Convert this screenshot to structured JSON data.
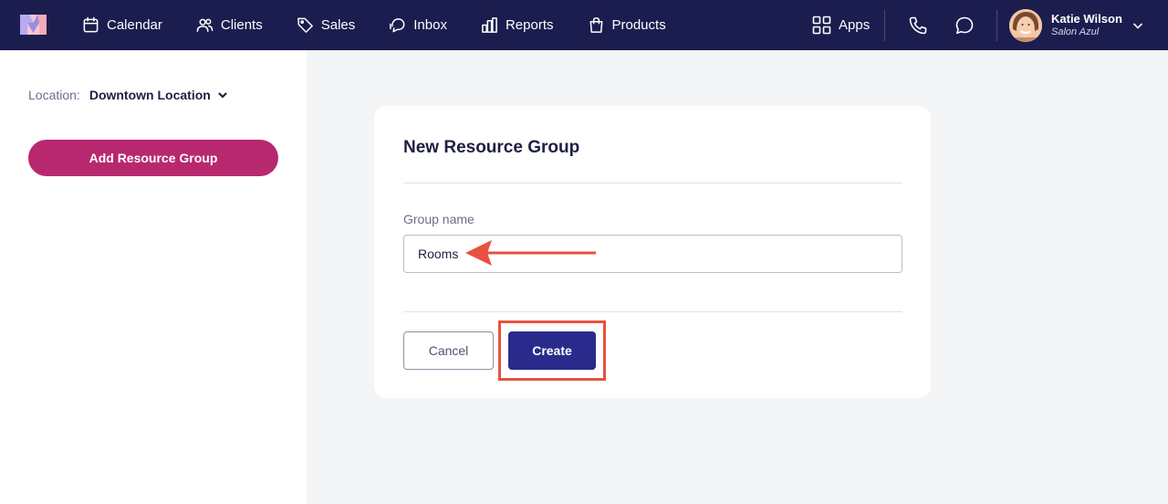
{
  "header": {
    "nav": [
      {
        "label": "Calendar",
        "icon": "calendar-icon"
      },
      {
        "label": "Clients",
        "icon": "clients-icon"
      },
      {
        "label": "Sales",
        "icon": "tag-icon"
      },
      {
        "label": "Inbox",
        "icon": "inbox-icon"
      },
      {
        "label": "Reports",
        "icon": "reports-icon"
      },
      {
        "label": "Products",
        "icon": "bag-icon"
      }
    ],
    "apps_label": "Apps",
    "user": {
      "name": "Katie Wilson",
      "business": "Salon Azul"
    }
  },
  "sidebar": {
    "location_label": "Location:",
    "location_value": "Downtown Location",
    "add_button": "Add Resource Group"
  },
  "dialog": {
    "title": "New Resource Group",
    "field_label": "Group name",
    "field_value": "Rooms",
    "cancel": "Cancel",
    "create": "Create"
  },
  "colors": {
    "nav_bg": "#1c1d4f",
    "accent_magenta": "#b8286f",
    "primary_button": "#2a2a8c",
    "annotation": "#e9503f",
    "page_bg": "#f4f5f7"
  }
}
